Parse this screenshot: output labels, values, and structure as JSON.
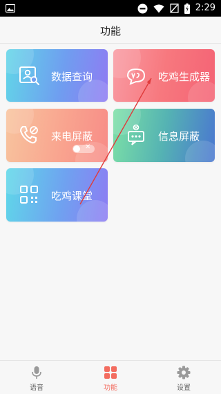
{
  "status_bar": {
    "time": "2:29",
    "icons": [
      "image-icon",
      "do-not-disturb-icon",
      "wifi-icon",
      "no-sim-icon",
      "battery-icon"
    ]
  },
  "header": {
    "title": "功能"
  },
  "tiles": [
    {
      "label": "数据查询",
      "icon": "data-query-icon"
    },
    {
      "label": "吃鸡生成器",
      "icon": "chat-bubble-icon"
    },
    {
      "label": "来电屏蔽",
      "icon": "phone-block-icon",
      "toggle": false
    },
    {
      "label": "信息屏蔽",
      "icon": "message-block-icon"
    },
    {
      "label": "吃鸡课堂",
      "icon": "qr-code-icon"
    }
  ],
  "annotation": {
    "type": "arrow",
    "color": "#e03a3a"
  },
  "tab_bar": {
    "active": "功能",
    "items": [
      {
        "label": "语音",
        "icon": "microphone-icon"
      },
      {
        "label": "功能",
        "icon": "grid-icon"
      },
      {
        "label": "设置",
        "icon": "gear-icon"
      }
    ]
  },
  "colors": {
    "accent": "#f36c5f",
    "background": "#f7f7f7"
  }
}
